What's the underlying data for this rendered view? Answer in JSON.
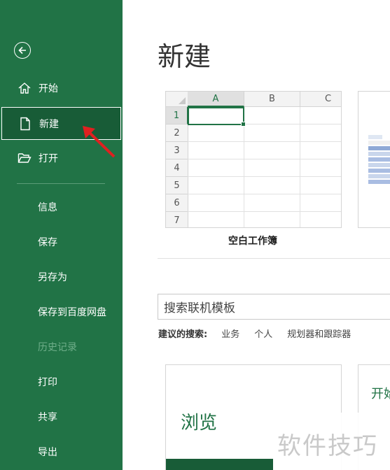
{
  "sidebar": {
    "items": [
      {
        "label": "开始",
        "icon": "home-icon"
      },
      {
        "label": "新建",
        "icon": "new-file-icon",
        "selected": true
      },
      {
        "label": "打开",
        "icon": "folder-open-icon"
      },
      {
        "label": "信息"
      },
      {
        "label": "保存"
      },
      {
        "label": "另存为"
      },
      {
        "label": "保存到百度网盘"
      },
      {
        "label": "历史记录",
        "disabled": true
      },
      {
        "label": "打印"
      },
      {
        "label": "共享"
      },
      {
        "label": "导出"
      }
    ]
  },
  "main": {
    "title": "新建",
    "blank_workbook": {
      "caption": "空白工作簿",
      "columns": [
        "A",
        "B",
        "C"
      ],
      "rows": [
        "1",
        "2",
        "3",
        "4",
        "5",
        "6",
        "7"
      ]
    },
    "browse_tile": {
      "label": "浏览"
    },
    "template_tile_partial": {
      "label": "开始"
    },
    "search": {
      "placeholder": "搜索联机模板"
    },
    "suggested": {
      "label": "建议的搜索:",
      "items": [
        "业务",
        "个人",
        "规划器和跟踪器"
      ]
    }
  },
  "watermark": {
    "text": "软件技巧"
  },
  "colors": {
    "accent": "#217346",
    "accent_dark": "#185c37",
    "annotation_arrow": "#e02020"
  }
}
